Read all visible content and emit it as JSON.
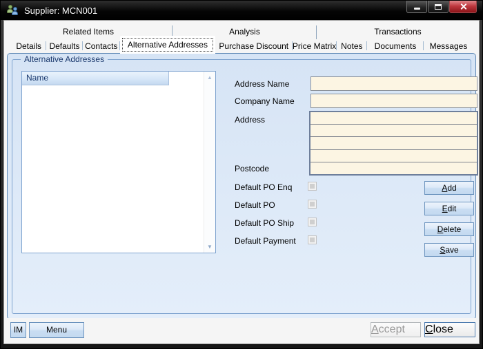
{
  "window": {
    "title": "Supplier: MCN001"
  },
  "icons": {
    "app": "two-users",
    "minimize": "dash",
    "maximize": "square",
    "close": "x-shape",
    "scroll_up": "▲",
    "scroll_down": "▼"
  },
  "tab_groups": [
    {
      "label": "Related Items"
    },
    {
      "label": "Analysis"
    },
    {
      "label": "Transactions"
    }
  ],
  "tabs": [
    {
      "label": "Details",
      "selected": false
    },
    {
      "label": "Defaults",
      "selected": false
    },
    {
      "label": "Contacts",
      "selected": false
    },
    {
      "label": "Alternative Addresses",
      "selected": true
    },
    {
      "label": "Purchase Discount",
      "selected": false
    },
    {
      "label": "Price Matrix",
      "selected": false
    },
    {
      "label": "Notes",
      "selected": false
    },
    {
      "label": "Documents",
      "selected": false
    },
    {
      "label": "Messages",
      "selected": false
    }
  ],
  "groupbox": {
    "title": "Alternative Addresses"
  },
  "list": {
    "header": "Name",
    "rows": []
  },
  "form": {
    "address_name_label": "Address Name",
    "address_name_value": "",
    "company_name_label": "Company Name",
    "company_name_value": "",
    "address_label": "Address",
    "address_lines": [
      "",
      "",
      "",
      ""
    ],
    "postcode_label": "Postcode",
    "postcode_value": "",
    "checkboxes": [
      {
        "label": "Default PO Enq",
        "checked": false
      },
      {
        "label": "Default PO",
        "checked": false
      },
      {
        "label": "Default PO Ship",
        "checked": false
      },
      {
        "label": "Default Payment",
        "checked": false
      }
    ],
    "buttons": [
      {
        "label": "Add",
        "key": "A"
      },
      {
        "label": "Edit",
        "key": "E"
      },
      {
        "label": "Delete",
        "key": "D"
      },
      {
        "label": "Save",
        "key": "S"
      }
    ]
  },
  "footer": {
    "im": {
      "label": "IM"
    },
    "menu": {
      "label": "Menu"
    },
    "accept": {
      "label": "Accept",
      "key": "A"
    },
    "close": {
      "label": "Close",
      "key": "C"
    }
  },
  "colors": {
    "panel-top": "#D6E4F5",
    "panel-bottom": "#E4EEFA",
    "panel-border": "#5E88B5",
    "groupbox-border": "#7EA3CF",
    "header-text": "#1C3A6E",
    "input-bg": "#FCF5E3",
    "button-border": "#6B93BE"
  }
}
